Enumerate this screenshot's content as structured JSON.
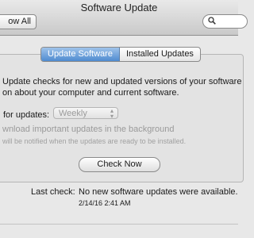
{
  "window": {
    "title": "Software Update"
  },
  "toolbar": {
    "show_all_label": "ow All",
    "search_placeholder": ""
  },
  "tabs": [
    {
      "label": "Update Software",
      "active": true
    },
    {
      "label": "Installed Updates",
      "active": false
    }
  ],
  "main": {
    "description_line1": "Update checks for new and updated versions of your software",
    "description_line2": "on about your computer and current software.",
    "check_label": "for updates:",
    "frequency_value": "Weekly",
    "download_label": "wnload important updates in the background",
    "notify_text": "will be notified when the updates are ready to be installed.",
    "check_now_label": "Check Now",
    "last_check_label": "Last check:",
    "last_check_value": "No new software updates were available.",
    "last_check_time": "2/14/16 2:41 AM"
  },
  "colors": {
    "accent": "#4f8bd0",
    "disabled_text": "#9b9b9b"
  }
}
